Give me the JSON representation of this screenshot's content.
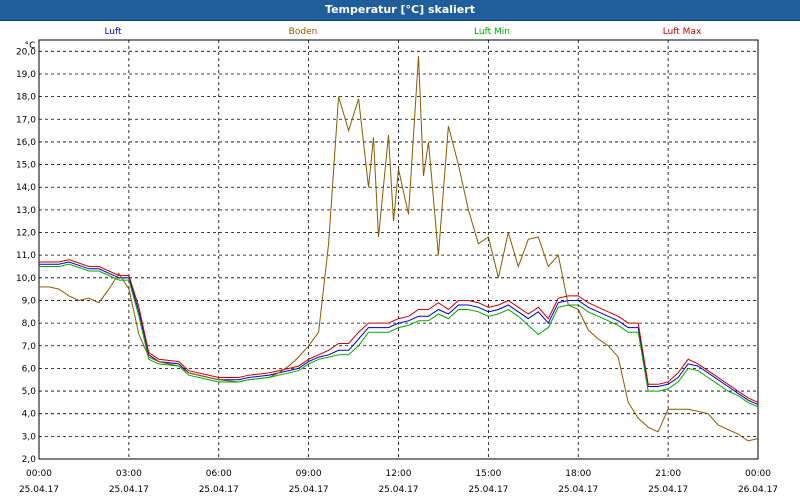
{
  "window": {
    "title": "Temperatur [°C] skaliert"
  },
  "chart_data": {
    "type": "line",
    "title": "Temperatur [°C] skaliert",
    "ylabel": "°C",
    "ylim": [
      2.0,
      20.5
    ],
    "xlim": [
      "25.04.17 00:00",
      "26.04.17 00:00"
    ],
    "grid": true,
    "legend_position": "top",
    "yticks": [
      "2,0",
      "3,0",
      "4,0",
      "5,0",
      "6,0",
      "7,0",
      "8,0",
      "9,0",
      "10,0",
      "11,0",
      "12,0",
      "13,0",
      "14,0",
      "15,0",
      "16,0",
      "17,0",
      "18,0",
      "19,0",
      "20,0"
    ],
    "xticks": [
      {
        "time": "00:00",
        "date": "25.04.17"
      },
      {
        "time": "03:00",
        "date": "25.04.17"
      },
      {
        "time": "06:00",
        "date": "25.04.17"
      },
      {
        "time": "09:00",
        "date": "25.04.17"
      },
      {
        "time": "12:00",
        "date": "25.04.17"
      },
      {
        "time": "15:00",
        "date": "25.04.17"
      },
      {
        "time": "18:00",
        "date": "25.04.17"
      },
      {
        "time": "21:00",
        "date": "25.04.17"
      },
      {
        "time": "00:00",
        "date": "26.04.17"
      }
    ],
    "series": [
      {
        "name": "Luft",
        "color": "#0000cc",
        "x": [
          "00:00",
          "00:40",
          "01:00",
          "01:40",
          "02:00",
          "02:40",
          "03:00",
          "03:20",
          "03:40",
          "04:00",
          "04:40",
          "05:00",
          "05:40",
          "06:00",
          "06:40",
          "07:00",
          "07:40",
          "08:00",
          "08:40",
          "09:00",
          "09:20",
          "09:40",
          "10:00",
          "10:20",
          "10:40",
          "11:00",
          "11:20",
          "11:40",
          "12:00",
          "12:20",
          "12:40",
          "13:00",
          "13:20",
          "13:40",
          "14:00",
          "14:20",
          "14:40",
          "15:00",
          "15:20",
          "15:40",
          "16:00",
          "16:20",
          "16:40",
          "17:00",
          "17:20",
          "17:40",
          "18:00",
          "18:20",
          "18:40",
          "19:00",
          "19:20",
          "19:40",
          "20:00",
          "20:20",
          "20:40",
          "21:00",
          "21:20",
          "21:40",
          "22:00",
          "22:20",
          "22:40",
          "23:00",
          "23:20",
          "23:40",
          "24:00"
        ],
        "values": [
          10.6,
          10.6,
          10.7,
          10.4,
          10.4,
          10.0,
          10.0,
          8.5,
          6.6,
          6.3,
          6.2,
          5.8,
          5.6,
          5.5,
          5.5,
          5.6,
          5.7,
          5.8,
          6.0,
          6.3,
          6.5,
          6.6,
          6.8,
          6.8,
          7.3,
          7.8,
          7.8,
          7.8,
          8.0,
          8.1,
          8.3,
          8.3,
          8.6,
          8.4,
          8.8,
          8.8,
          8.7,
          8.5,
          8.6,
          8.8,
          8.5,
          8.2,
          8.5,
          8.0,
          8.9,
          9.0,
          9.0,
          8.7,
          8.5,
          8.3,
          8.1,
          7.8,
          7.8,
          5.2,
          5.2,
          5.3,
          5.6,
          6.2,
          6.1,
          5.8,
          5.5,
          5.2,
          4.9,
          4.6,
          4.4
        ]
      },
      {
        "name": "Boden",
        "color": "#8b5a00",
        "x": [
          "00:00",
          "00:20",
          "00:40",
          "01:00",
          "01:20",
          "01:40",
          "02:00",
          "02:20",
          "02:40",
          "03:00",
          "03:20",
          "03:40",
          "04:00",
          "04:40",
          "05:00",
          "05:40",
          "06:00",
          "06:40",
          "07:00",
          "07:40",
          "08:00",
          "08:20",
          "08:40",
          "09:00",
          "09:20",
          "09:40",
          "10:00",
          "10:20",
          "10:40",
          "11:00",
          "11:10",
          "11:20",
          "11:40",
          "11:50",
          "12:00",
          "12:20",
          "12:40",
          "12:50",
          "13:00",
          "13:20",
          "13:40",
          "14:00",
          "14:20",
          "14:40",
          "15:00",
          "15:20",
          "15:40",
          "16:00",
          "16:20",
          "16:40",
          "17:00",
          "17:20",
          "17:40",
          "18:00",
          "18:20",
          "18:40",
          "19:00",
          "19:20",
          "19:40",
          "20:00",
          "20:20",
          "20:40",
          "21:00",
          "21:20",
          "21:40",
          "22:00",
          "22:20",
          "22:40",
          "23:00",
          "23:20",
          "23:40",
          "24:00"
        ],
        "values": [
          9.6,
          9.6,
          9.5,
          9.2,
          9.0,
          9.1,
          8.9,
          9.5,
          10.2,
          9.5,
          7.5,
          6.5,
          6.3,
          6.1,
          5.8,
          5.6,
          5.5,
          5.4,
          5.5,
          5.6,
          5.8,
          6.1,
          6.5,
          7.0,
          7.6,
          11.5,
          18.0,
          16.5,
          17.9,
          14.0,
          16.2,
          11.8,
          16.3,
          12.5,
          14.8,
          12.8,
          19.8,
          14.5,
          16.0,
          11.0,
          16.7,
          15.0,
          13.0,
          11.5,
          11.8,
          10.0,
          12.0,
          10.5,
          11.7,
          11.8,
          10.5,
          11.0,
          8.8,
          8.6,
          7.7,
          7.3,
          7.0,
          6.5,
          4.5,
          3.8,
          3.4,
          3.2,
          4.2,
          4.2,
          4.2,
          4.1,
          4.0,
          3.5,
          3.3,
          3.1,
          2.8,
          2.9
        ]
      },
      {
        "name": "Luft Min",
        "color": "#00aa00",
        "x": [
          "00:00",
          "00:40",
          "01:00",
          "01:40",
          "02:00",
          "02:40",
          "03:00",
          "03:20",
          "03:40",
          "04:00",
          "04:40",
          "05:00",
          "05:40",
          "06:00",
          "06:40",
          "07:00",
          "07:40",
          "08:00",
          "08:40",
          "09:00",
          "09:20",
          "09:40",
          "10:00",
          "10:20",
          "10:40",
          "11:00",
          "11:20",
          "11:40",
          "12:00",
          "12:20",
          "12:40",
          "13:00",
          "13:20",
          "13:40",
          "14:00",
          "14:20",
          "14:40",
          "15:00",
          "15:20",
          "15:40",
          "16:00",
          "16:20",
          "16:40",
          "17:00",
          "17:20",
          "17:40",
          "18:00",
          "18:20",
          "18:40",
          "19:00",
          "19:20",
          "19:40",
          "20:00",
          "20:20",
          "20:40",
          "21:00",
          "21:20",
          "21:40",
          "22:00",
          "22:20",
          "22:40",
          "23:00",
          "23:20",
          "23:40",
          "24:00"
        ],
        "values": [
          10.5,
          10.5,
          10.6,
          10.3,
          10.3,
          9.9,
          9.9,
          8.3,
          6.4,
          6.2,
          6.1,
          5.7,
          5.5,
          5.4,
          5.4,
          5.5,
          5.6,
          5.7,
          5.9,
          6.2,
          6.4,
          6.5,
          6.6,
          6.6,
          7.0,
          7.6,
          7.6,
          7.6,
          7.8,
          7.9,
          8.1,
          8.1,
          8.4,
          8.2,
          8.6,
          8.6,
          8.5,
          8.3,
          8.4,
          8.6,
          8.3,
          7.9,
          7.5,
          7.8,
          8.7,
          8.8,
          8.8,
          8.5,
          8.3,
          8.1,
          7.9,
          7.6,
          7.6,
          5.0,
          5.0,
          5.1,
          5.4,
          6.0,
          5.9,
          5.6,
          5.3,
          5.0,
          4.8,
          4.5,
          4.3
        ]
      },
      {
        "name": "Luft Max",
        "color": "#cc0000",
        "x": [
          "00:00",
          "00:40",
          "01:00",
          "01:40",
          "02:00",
          "02:40",
          "03:00",
          "03:20",
          "03:40",
          "04:00",
          "04:40",
          "05:00",
          "05:40",
          "06:00",
          "06:40",
          "07:00",
          "07:40",
          "08:00",
          "08:40",
          "09:00",
          "09:20",
          "09:40",
          "10:00",
          "10:20",
          "10:40",
          "11:00",
          "11:20",
          "11:40",
          "12:00",
          "12:20",
          "12:40",
          "13:00",
          "13:20",
          "13:40",
          "14:00",
          "14:20",
          "14:40",
          "15:00",
          "15:20",
          "15:40",
          "16:00",
          "16:20",
          "16:40",
          "17:00",
          "17:20",
          "17:40",
          "18:00",
          "18:20",
          "18:40",
          "19:00",
          "19:20",
          "19:40",
          "20:00",
          "20:20",
          "20:40",
          "21:00",
          "21:20",
          "21:40",
          "22:00",
          "22:20",
          "22:40",
          "23:00",
          "23:20",
          "23:40",
          "24:00"
        ],
        "values": [
          10.7,
          10.7,
          10.8,
          10.5,
          10.5,
          10.1,
          10.1,
          8.7,
          6.7,
          6.4,
          6.3,
          5.9,
          5.7,
          5.6,
          5.6,
          5.7,
          5.8,
          5.9,
          6.1,
          6.4,
          6.6,
          6.8,
          7.1,
          7.1,
          7.6,
          8.0,
          8.0,
          8.0,
          8.2,
          8.3,
          8.6,
          8.6,
          8.9,
          8.6,
          9.0,
          9.0,
          8.9,
          8.7,
          8.8,
          9.0,
          8.7,
          8.4,
          8.7,
          8.2,
          9.1,
          9.2,
          9.2,
          8.9,
          8.7,
          8.5,
          8.3,
          8.0,
          8.0,
          5.3,
          5.3,
          5.4,
          5.8,
          6.4,
          6.2,
          5.9,
          5.6,
          5.3,
          5.0,
          4.7,
          4.5
        ]
      }
    ]
  }
}
